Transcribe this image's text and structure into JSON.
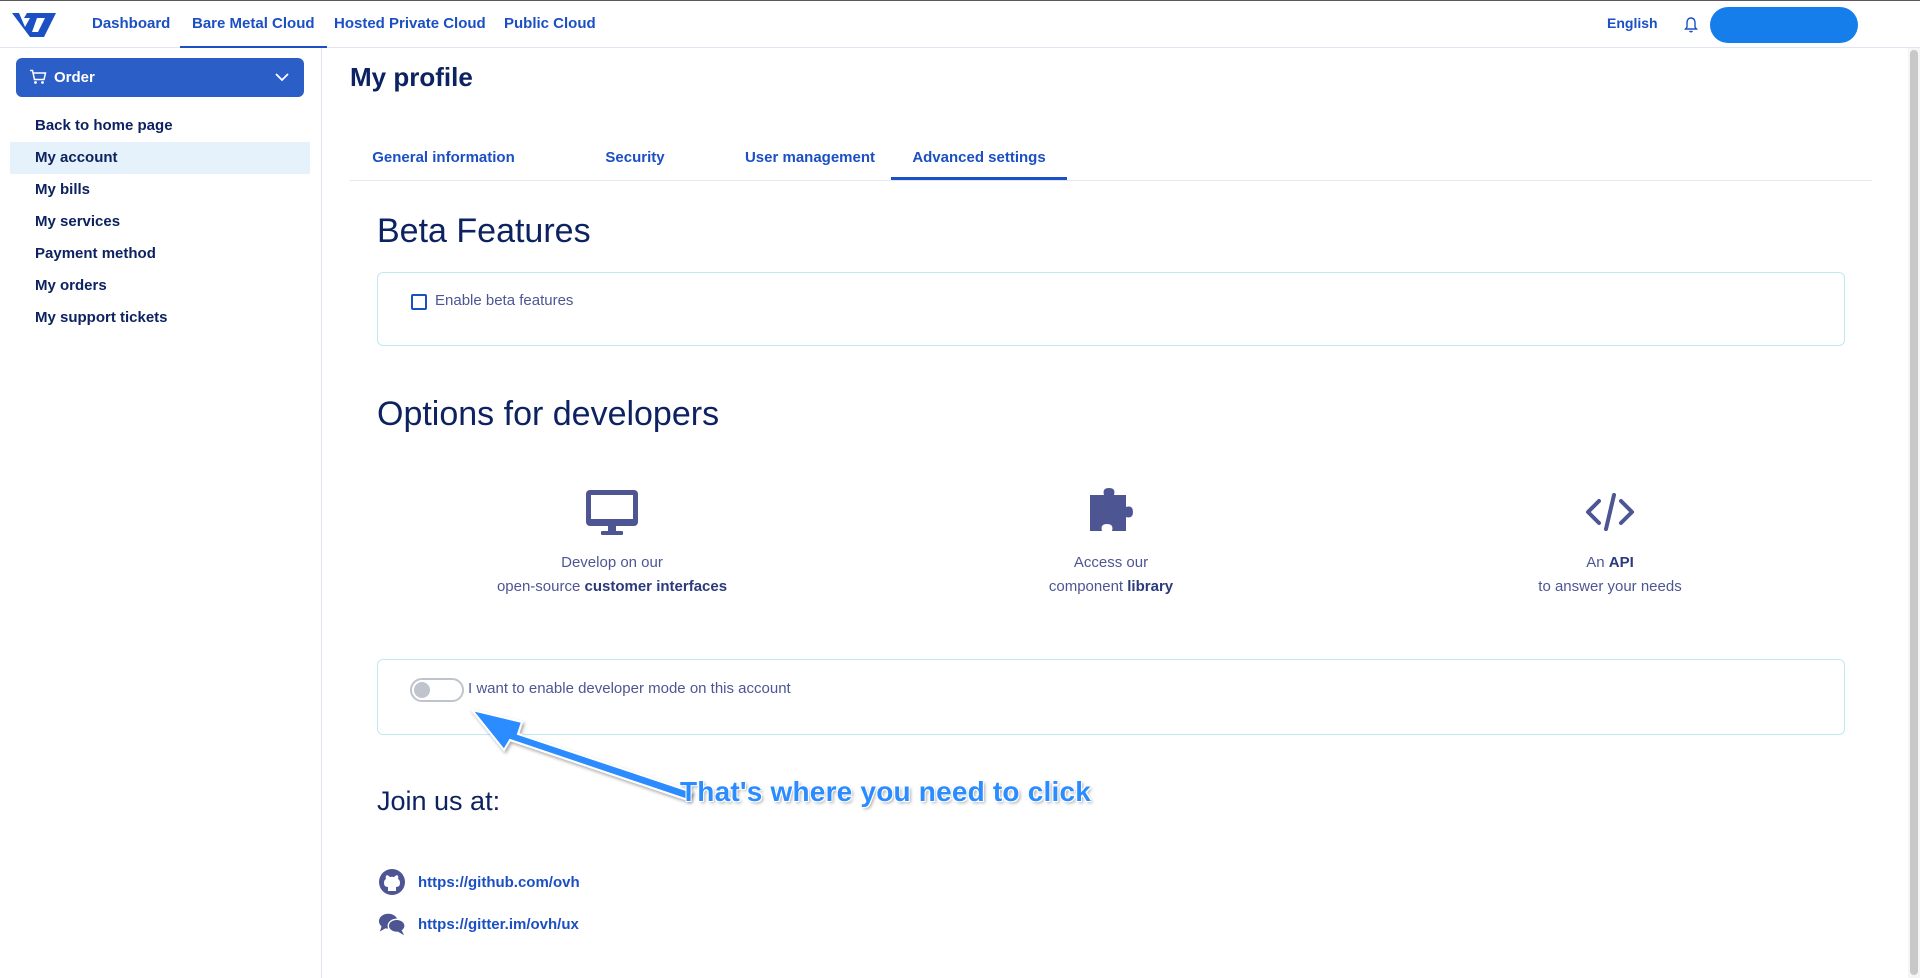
{
  "topnav": {
    "links": [
      "Dashboard",
      "Bare Metal Cloud",
      "Hosted Private Cloud",
      "Public Cloud"
    ],
    "active_index": 1,
    "language": "English",
    "user_button_label": ""
  },
  "sidebar": {
    "order_label": "Order",
    "items": [
      "Back to home page",
      "My account",
      "My bills",
      "My services",
      "Payment method",
      "My orders",
      "My support tickets"
    ],
    "active_index": 1
  },
  "main": {
    "title": "My profile",
    "tabs": [
      "General information",
      "Security",
      "User management",
      "Advanced settings"
    ],
    "active_tab": 3,
    "beta": {
      "heading": "Beta Features",
      "checkbox_label": "Enable beta features",
      "checked": false
    },
    "developers": {
      "heading": "Options for developers",
      "cards": [
        {
          "icon": "monitor-icon",
          "line1": "Develop on our",
          "line2_prefix": "open-source ",
          "line2_bold": "customer interfaces"
        },
        {
          "icon": "puzzle-icon",
          "line1": "Access our",
          "line2_prefix": "component ",
          "line2_bold": "library"
        },
        {
          "icon": "code-icon",
          "line1_prefix": "An ",
          "line1_bold": "API",
          "line2": "to answer your needs"
        }
      ],
      "toggle_label": "I want to enable developer mode on this account",
      "toggle_on": false
    },
    "join": {
      "heading": "Join us at:",
      "links": [
        {
          "icon": "github-icon",
          "url": "https://github.com/ovh"
        },
        {
          "icon": "chat-icon",
          "url": "https://gitter.im/ovh/ux"
        }
      ]
    }
  },
  "annotation": {
    "text": "That's where you need to click",
    "color": "#2b8cff"
  },
  "colors": {
    "brand": "#1b4fc4",
    "primary_button": "#2c5ec8",
    "heading": "#0d2260",
    "tile_border": "#bfe8f5"
  }
}
